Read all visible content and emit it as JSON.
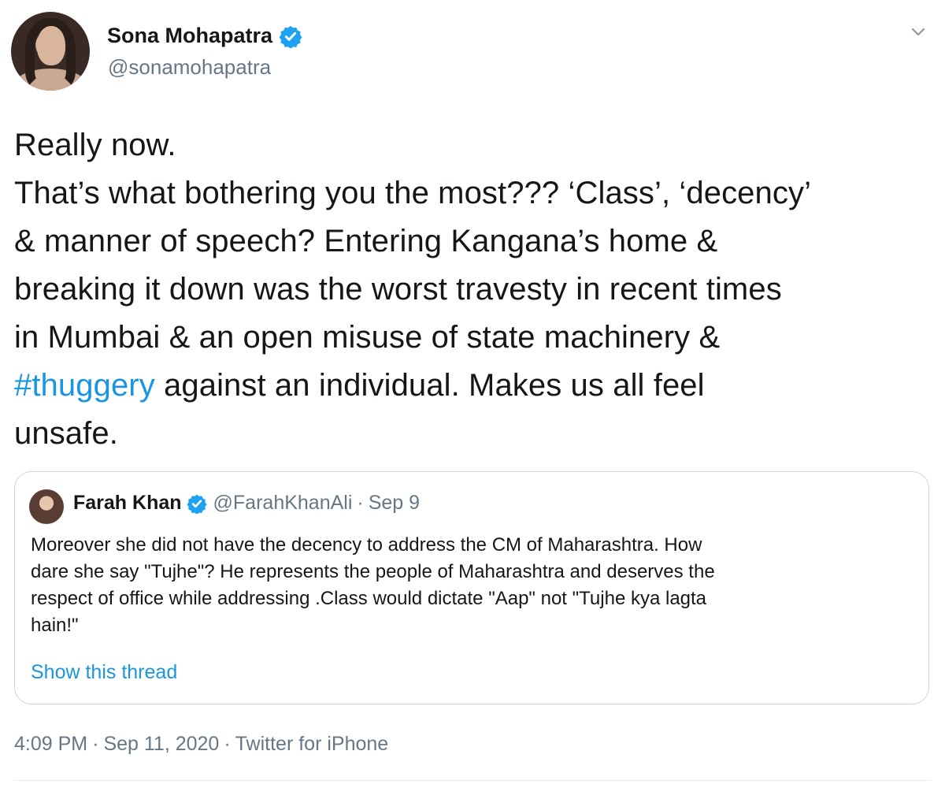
{
  "tweet": {
    "author": {
      "name": "Sona Mohapatra",
      "handle": "@sonamohapatra"
    },
    "text_lines": [
      "Really now.",
      "That’s what bothering you the most??? ‘Class’, ‘decency’",
      "& manner of speech? Entering Kangana’s home &",
      "breaking it down was the worst travesty in recent times",
      "in Mumbai & an open misuse of state machinery &"
    ],
    "hashtag": "#thuggery",
    "after_hashtag": " against an individual. Makes us all feel",
    "last_line": "unsafe.",
    "timestamp": "4:09 PM",
    "date": "Sep 11, 2020",
    "source": "Twitter for iPhone",
    "separator": "·"
  },
  "quoted_tweet": {
    "author": {
      "name": "Farah Khan",
      "handle": "@FarahKhanAli"
    },
    "separator": "·",
    "date": "Sep 9",
    "text_lines": [
      "Moreover she did not have the decency to address the CM of Maharashtra. How",
      "dare she say \"Tujhe\"? He represents the people of Maharashtra and deserves the",
      "respect of office while addressing .Class would dictate \"Aap\" not \"Tujhe kya lagta",
      "hain!\""
    ],
    "show_thread": "Show this thread"
  },
  "colors": {
    "accent": "#1b95e0",
    "verified": "#1da1f2",
    "secondary_text": "#657786",
    "border": "#ccd6dd"
  },
  "icons": {
    "verified": "verified-badge-icon",
    "more": "chevron-down-icon"
  }
}
